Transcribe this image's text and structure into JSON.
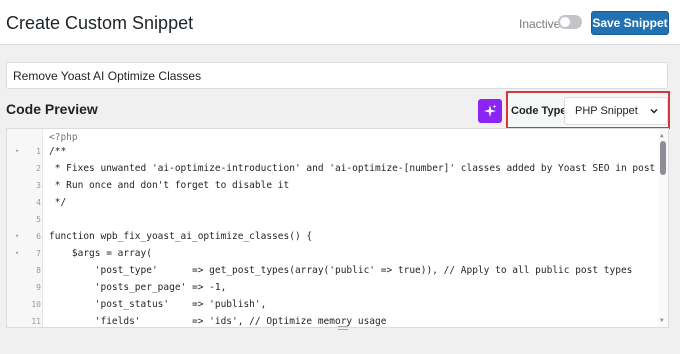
{
  "header": {
    "title": "Create Custom Snippet",
    "status_label": "Inactive",
    "save_label": "Save Snippet"
  },
  "snippet": {
    "title_value": "Remove Yoast AI Optimize Classes"
  },
  "code_preview": {
    "title": "Code Preview",
    "ai_icon": "sparkle-icon",
    "code_type_label": "Code Type",
    "code_type_value": "PHP Snippet"
  },
  "editor": {
    "header_line": "<?php",
    "lines": [
      {
        "num": "1",
        "fold": true,
        "text": "/**"
      },
      {
        "num": "2",
        "fold": false,
        "text": " * Fixes unwanted 'ai-optimize-introduction' and 'ai-optimize-[number]' classes added by Yoast SEO in post content."
      },
      {
        "num": "3",
        "fold": false,
        "text": " * Run once and don't forget to disable it"
      },
      {
        "num": "4",
        "fold": false,
        "text": " */"
      },
      {
        "num": "5",
        "fold": false,
        "text": ""
      },
      {
        "num": "6",
        "fold": true,
        "text": "function wpb_fix_yoast_ai_optimize_classes() {"
      },
      {
        "num": "7",
        "fold": true,
        "text": "    $args = array("
      },
      {
        "num": "8",
        "fold": false,
        "text": "        'post_type'      => get_post_types(array('public' => true)), // Apply to all public post types"
      },
      {
        "num": "9",
        "fold": false,
        "text": "        'posts_per_page' => -1,"
      },
      {
        "num": "10",
        "fold": false,
        "text": "        'post_status'    => 'publish',"
      },
      {
        "num": "11",
        "fold": false,
        "text": "        'fields'         => 'ids', // Optimize memory usage"
      }
    ]
  },
  "colors": {
    "primary": "#2271b1",
    "ai_purple": "#8c25f2",
    "highlight_red": "#d63638"
  }
}
